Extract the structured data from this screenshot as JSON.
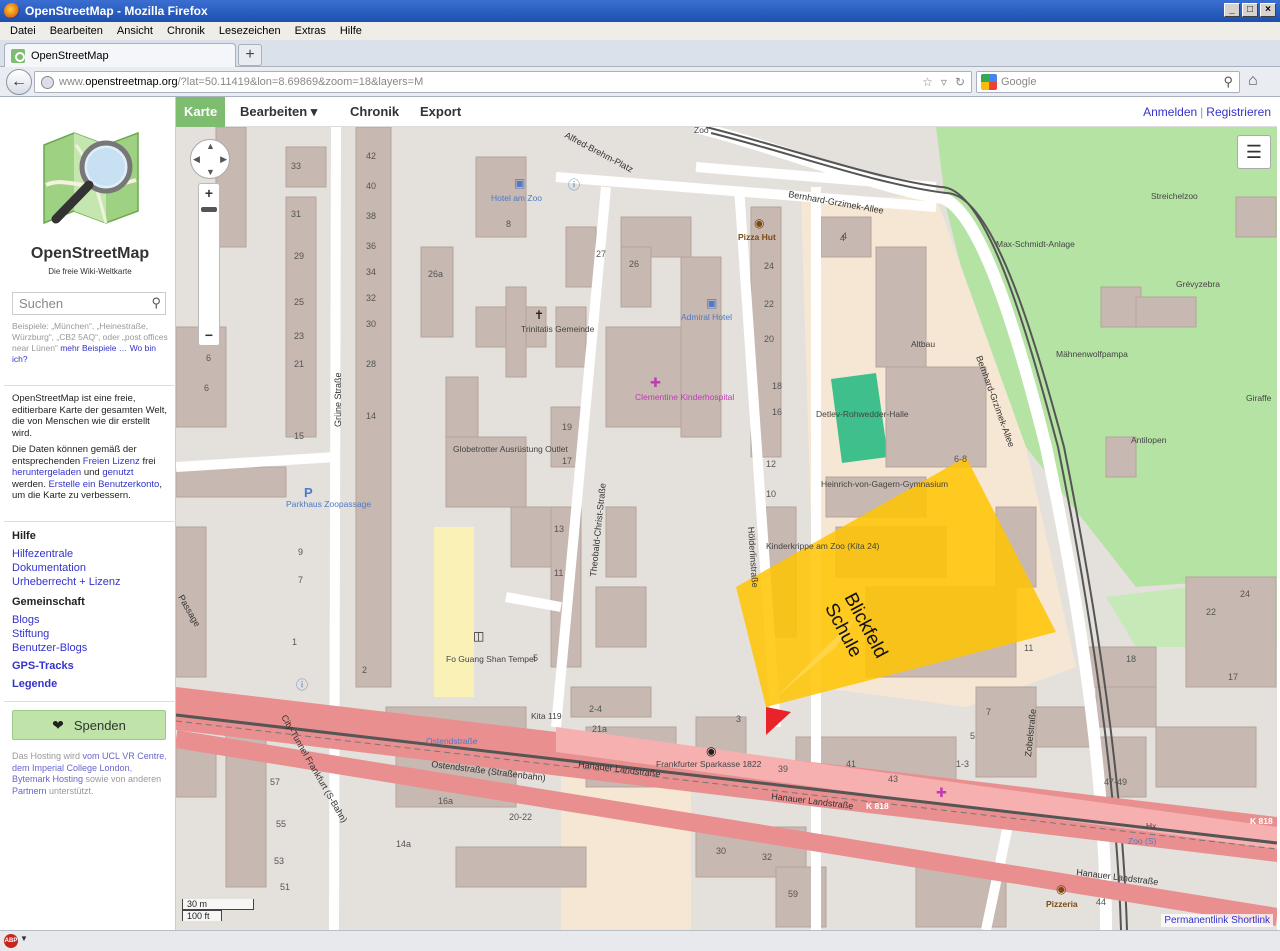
{
  "window": {
    "title": "OpenStreetMap - Mozilla Firefox",
    "buttons": [
      "_",
      "□",
      "×"
    ]
  },
  "menubar": [
    "Datei",
    "Bearbeiten",
    "Ansicht",
    "Chronik",
    "Lesezeichen",
    "Extras",
    "Hilfe"
  ],
  "tab": {
    "label": "OpenStreetMap",
    "new_tab": "+"
  },
  "navbar": {
    "url_www": "www.",
    "url_host": "openstreetmap.org",
    "url_rest": "/?lat=50.11419&lon=8.69869&zoom=18&layers=M",
    "search_placeholder": "Google"
  },
  "sidebar": {
    "title": "OpenStreetMap",
    "tagline": "Die freie Wiki-Weltkarte",
    "search_placeholder": "Suchen",
    "example": "Beispiele: „München“, „Heinestraße, Würzburg“, „CB2 5AQ“, oder „post offices near Lünen“",
    "example_link": "mehr Beispiele …",
    "example_link2": "Wo bin ich?",
    "intro_1": "OpenStreetMap ist eine freie, editierbare Karte der gesamten Welt, die von Menschen wie dir erstellt wird.",
    "intro_2a": "Die Daten können gemäß der entsprechenden ",
    "intro_2_link1": "Freien Lizenz",
    "intro_2b": " frei ",
    "intro_2_link2": "heruntergeladen",
    "intro_2c": " und ",
    "intro_2_link3": "genutzt",
    "intro_2d": " werden. ",
    "intro_2_link4": "Erstelle ein Benutzerkonto",
    "intro_2e": ", um die Karte zu verbessern.",
    "help_head": "Hilfe",
    "help_links": [
      "Hilfezentrale",
      "Dokumentation",
      "Urheberrecht + Lizenz"
    ],
    "community_head": "Gemeinschaft",
    "community_links": [
      "Blogs",
      "Stiftung",
      "Benutzer-Blogs"
    ],
    "gps_tracks": "GPS-Tracks",
    "legend": "Legende",
    "donate": "Spenden",
    "hosting_a": "Das Hosting wird ",
    "hosting_link1": "vom UCL VR Centre",
    "hosting_b": ", ",
    "hosting_link2": "dem Imperial College London",
    "hosting_c": ", ",
    "hosting_link3": "Bytemark Hosting",
    "hosting_d": " sowie von anderen ",
    "hosting_link4": "Partnern",
    "hosting_e": " unterstützt."
  },
  "map_header": {
    "tabs": [
      "Karte",
      "Bearbeiten ▾",
      "Chronik",
      "Export"
    ],
    "login": "Anmelden",
    "separator": "|",
    "register": "Registrieren"
  },
  "map": {
    "streets": [
      "Grüne Straße",
      "Theobald-Christ-Straße",
      "Hölderlinstraße",
      "Alfred-Brehm-Platz",
      "Bernhard-Grzimek-Allee",
      "Hanauer Landstraße",
      "Hanauer Landstraße",
      "Hanauer Landstraße",
      "Ostendstraße (Straßenbahn)",
      "City-Tunnel Frankfurt (S-Bahn)",
      "Zobelstraße",
      "Bernhard-Grzimek-Allee",
      "Passage"
    ],
    "pois": [
      "Hotel am Zoo",
      "Admiral Hotel",
      "Pizza Hut",
      "Trinitatis Gemeinde",
      "Clementine Kinderhospital",
      "Globetrotter Ausrüstung Outlet",
      "Detlev-Rohwedder-Halle",
      "Heinrich-von-Gagern-Gymnasium",
      "Altbau",
      "Streichelzoo",
      "Max-Schmidt-Anlage",
      "Grévyzebra",
      "Mähnenwolfpampa",
      "Giraffe",
      "Antilopen",
      "Parkhaus Zoopassage",
      "Fo Guang Shan Tempel",
      "Frankfurter Sparkasse 1822",
      "Kita 119",
      "Kinderkrippe am Zoo (Kita 24)",
      "Ostendstraße",
      "Pizzeria",
      "Zoo",
      "Zoo (S)",
      "K 818",
      "K 818",
      "Hx"
    ],
    "house_numbers": [
      "33",
      "31",
      "29",
      "27",
      "25",
      "23",
      "21",
      "19",
      "17",
      "15",
      "13",
      "11",
      "9",
      "7",
      "5",
      "3",
      "42",
      "40",
      "38",
      "36",
      "34",
      "32",
      "30",
      "28",
      "26",
      "24",
      "22",
      "20",
      "18",
      "16",
      "14",
      "12",
      "10",
      "8",
      "6",
      "4",
      "2",
      "21a",
      "2-4",
      "26a",
      "1",
      "39",
      "41",
      "43",
      "47-49",
      "16a",
      "20-22",
      "14a",
      "51",
      "53",
      "55",
      "57",
      "59",
      "44",
      "30",
      "32",
      "1-3",
      "5",
      "7",
      "6-8",
      "11",
      "17",
      "22",
      "24",
      "18",
      "6",
      "4"
    ],
    "overlay_label": "Blickfeld\nSchule",
    "scale_m": "30 m",
    "scale_ft": "100 ft",
    "permalink": "Permanentlink",
    "shortlink": "Shortlink"
  },
  "colors": {
    "osm_green": "#7ebc6f",
    "link": "#3333cc",
    "overlay_yellow": "#ffc400",
    "marker_red": "#e8232a",
    "primary_road": "#e98f8f",
    "park": "#aedca0"
  }
}
